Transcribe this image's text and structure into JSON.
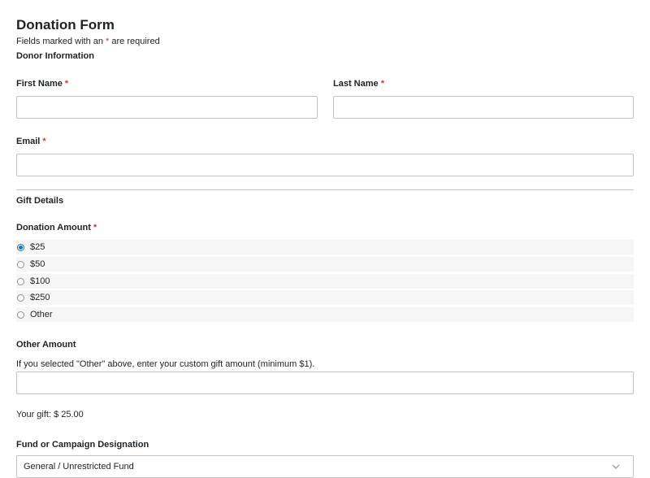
{
  "form": {
    "title": "Donation Form",
    "required_note_prefix": "Fields marked with an ",
    "required_star": "*",
    "required_note_suffix": " are required"
  },
  "donor_section": {
    "title": "Donor Information",
    "first_name_label": "First Name",
    "last_name_label": "Last Name",
    "email_label": "Email",
    "first_name_value": "",
    "last_name_value": "",
    "email_value": ""
  },
  "gift_section": {
    "title": "Gift Details",
    "amount_label": "Donation Amount",
    "amount_options": [
      {
        "label": "$25",
        "checked": true
      },
      {
        "label": "$50",
        "checked": false
      },
      {
        "label": "$100",
        "checked": false
      },
      {
        "label": "$250",
        "checked": false
      },
      {
        "label": "Other",
        "checked": false
      }
    ],
    "other_label": "Other Amount",
    "other_description": "If you selected \"Other\" above, enter your custom gift amount (minimum $1).",
    "other_value": "",
    "your_gift_text": "Your gift: $ 25.00",
    "fund_label": "Fund or Campaign Designation",
    "fund_selected": "General / Unrestricted Fund"
  },
  "colors": {
    "required": "#d63638",
    "radio_checked": "#2271b1",
    "border": "#c3c4c7",
    "option_bg": "#f6f6f6"
  }
}
